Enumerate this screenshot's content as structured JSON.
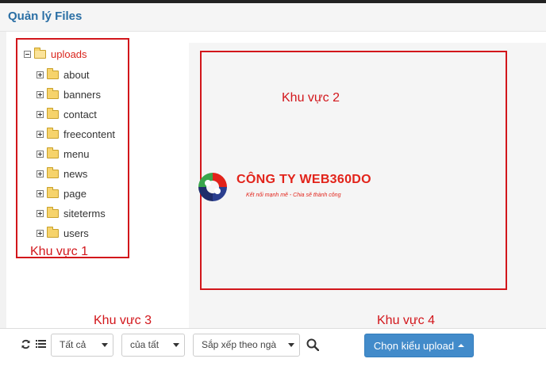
{
  "header": {
    "title": "Quản lý Files"
  },
  "tree": {
    "root": {
      "label": "uploads"
    },
    "children": [
      {
        "label": "about"
      },
      {
        "label": "banners"
      },
      {
        "label": "contact"
      },
      {
        "label": "freecontent"
      },
      {
        "label": "menu"
      },
      {
        "label": "news"
      },
      {
        "label": "page"
      },
      {
        "label": "siteterms"
      },
      {
        "label": "users"
      }
    ]
  },
  "zones": {
    "zone1": "Khu vực 1",
    "zone2": "Khu vực 2",
    "zone3": "Khu vực 3",
    "zone4": "Khu vực 4"
  },
  "logo": {
    "name": "CÔNG TY WEB360DO",
    "tagline": "Kết nối mạnh mẽ - Chia sẽ thành công"
  },
  "toolbar": {
    "filter_type": "Tất cả",
    "filter_owner": "của tất",
    "sort_by": "Sắp xếp theo ngà",
    "upload_button": "Chọn kiểu upload"
  },
  "colors": {
    "accent_blue": "#428bca",
    "annotation_red": "#d2161b",
    "title_blue": "#2a6fa5"
  }
}
